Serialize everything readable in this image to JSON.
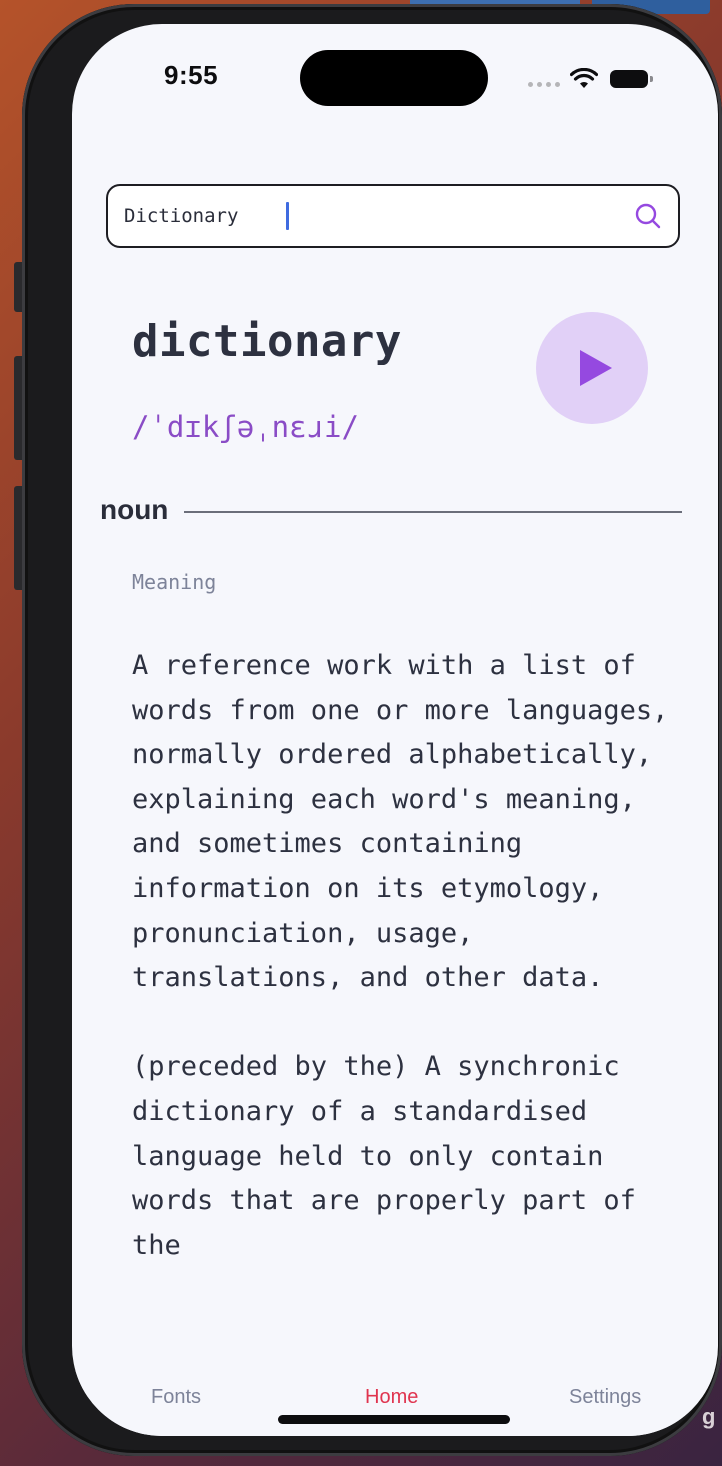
{
  "status_bar": {
    "time": "9:55"
  },
  "search": {
    "value": "Dictionary",
    "icon": "search-icon"
  },
  "entry": {
    "word": "dictionary",
    "phonetic": "/ˈdɪkʃəˌnɛɹi/",
    "play_icon": "play-icon",
    "part_of_speech": "noun",
    "meaning_heading": "Meaning",
    "definitions": [
      "A reference work with a list of words from one or more languages, normally ordered alphabetically, explaining each word's meaning, and sometimes containing information on its etymology, pronunciation, usage, translations, and other data.",
      "(preceded by the) A synchronic dictionary of a standardised language held to only contain words that are properly part of the"
    ]
  },
  "tabs": [
    {
      "label": "Fonts"
    },
    {
      "label": "Home"
    },
    {
      "label": "Settings"
    }
  ],
  "background_corner_text": "g",
  "colors": {
    "accent_purple": "#8a4cc6",
    "play_button_bg": "#e1d0f7",
    "active_tab": "#e0344f",
    "inactive_tab": "#7d8399",
    "text_primary": "#2d3140",
    "screen_bg": "#f6f7fc"
  }
}
